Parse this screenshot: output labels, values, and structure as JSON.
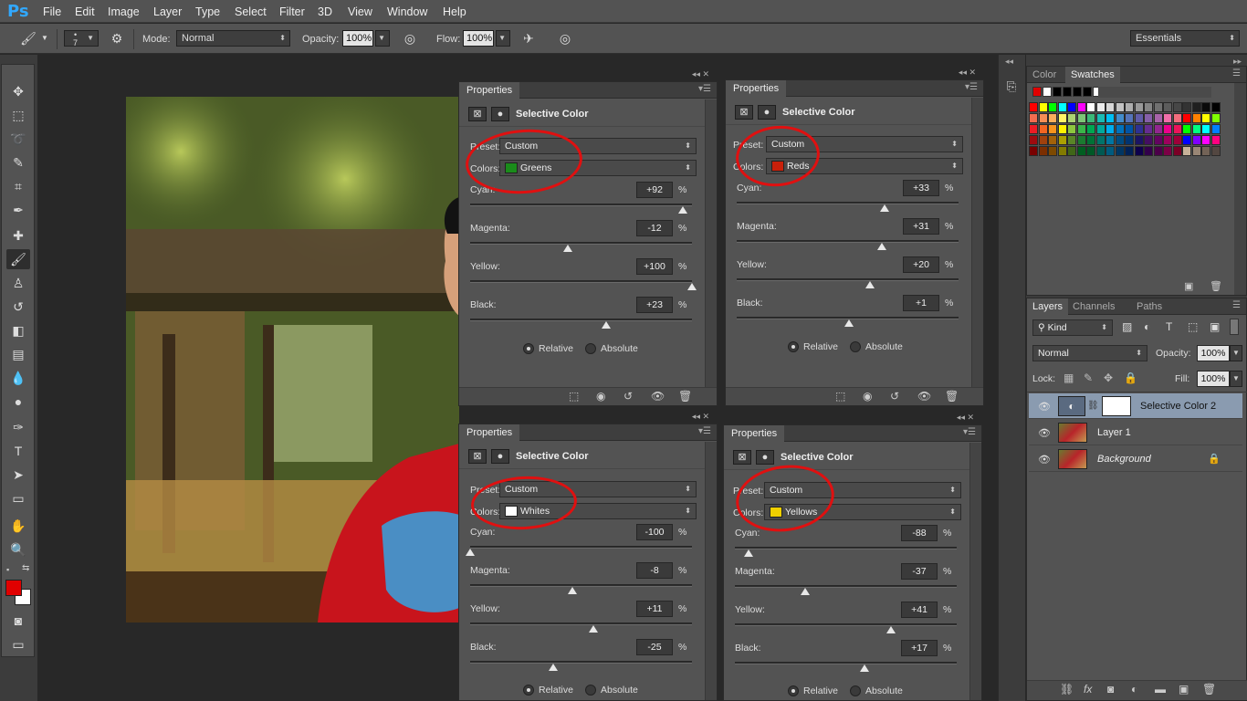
{
  "app": {
    "logo": "Ps",
    "menu": [
      "File",
      "Edit",
      "Image",
      "Layer",
      "Type",
      "Select",
      "Filter",
      "3D",
      "View",
      "Window",
      "Help"
    ]
  },
  "options_bar": {
    "brush_size": "7",
    "mode_label": "Mode:",
    "mode_value": "Normal",
    "opacity_label": "Opacity:",
    "opacity_value": "100%",
    "flow_label": "Flow:",
    "flow_value": "100%",
    "workspace": "Essentials"
  },
  "tools": {
    "foreground_color": "#e00000",
    "background_color": "#ffffff"
  },
  "panels": [
    {
      "tab": "Properties",
      "title": "Selective Color",
      "preset_label": "Preset:",
      "preset_value": "Custom",
      "colors_label": "Colors:",
      "colors_value": "Greens",
      "colors_swatch": "#1a8c1a",
      "sliders": [
        {
          "label": "Cyan:",
          "value": "+92",
          "level": 0.96
        },
        {
          "label": "Magenta:",
          "value": "-12",
          "level": 0.44
        },
        {
          "label": "Yellow:",
          "value": "+100",
          "level": 1.0
        },
        {
          "label": "Black:",
          "value": "+23",
          "level": 0.615
        }
      ],
      "pct": "%",
      "relative": "Relative",
      "absolute": "Absolute",
      "mode": "relative"
    },
    {
      "tab": "Properties",
      "title": "Selective Color",
      "preset_label": "Preset:",
      "preset_value": "Custom",
      "colors_label": "Colors:",
      "colors_value": "Reds",
      "colors_swatch": "#c8200a",
      "sliders": [
        {
          "label": "Cyan:",
          "value": "+33",
          "level": 0.665
        },
        {
          "label": "Magenta:",
          "value": "+31",
          "level": 0.655
        },
        {
          "label": "Yellow:",
          "value": "+20",
          "level": 0.6
        },
        {
          "label": "Black:",
          "value": "+1",
          "level": 0.505
        }
      ],
      "pct": "%",
      "relative": "Relative",
      "absolute": "Absolute",
      "mode": "relative"
    },
    {
      "tab": "Properties",
      "title": "Selective Color",
      "preset_label": "Preset:",
      "preset_value": "Custom",
      "colors_label": "Colors:",
      "colors_value": "Whites",
      "colors_swatch": "#ffffff",
      "sliders": [
        {
          "label": "Cyan:",
          "value": "-100",
          "level": 0.0
        },
        {
          "label": "Magenta:",
          "value": "-8",
          "level": 0.46
        },
        {
          "label": "Yellow:",
          "value": "+11",
          "level": 0.555
        },
        {
          "label": "Black:",
          "value": "-25",
          "level": 0.375
        }
      ],
      "pct": "%",
      "relative": "Relative",
      "absolute": "Absolute",
      "mode": "relative"
    },
    {
      "tab": "Properties",
      "title": "Selective Color",
      "preset_label": "Preset:",
      "preset_value": "Custom",
      "colors_label": "Colors:",
      "colors_value": "Yellows",
      "colors_swatch": "#f0d000",
      "sliders": [
        {
          "label": "Cyan:",
          "value": "-88",
          "level": 0.06
        },
        {
          "label": "Magenta:",
          "value": "-37",
          "level": 0.315
        },
        {
          "label": "Yellow:",
          "value": "+41",
          "level": 0.705
        },
        {
          "label": "Black:",
          "value": "+17",
          "level": 0.585
        }
      ],
      "pct": "%",
      "relative": "Relative",
      "absolute": "Absolute",
      "mode": "relative"
    }
  ],
  "color_panel": {
    "tabs": [
      "Color",
      "Swatches"
    ],
    "recent": [
      "#e00000",
      "#ffffff",
      "#000000",
      "#000000",
      "#000000",
      "#000000",
      "#ffffff"
    ],
    "rows": [
      [
        "#ff0000",
        "#ffff00",
        "#00ff00",
        "#00ffff",
        "#0000ff",
        "#ff00ff",
        "#ffffff",
        "#ebebeb",
        "#d6d6d6",
        "#c2c2c2",
        "#adadad",
        "#999999",
        "#858585",
        "#707070",
        "#5c5c5c",
        "#474747",
        "#333333",
        "#1f1f1f",
        "#0a0a0a",
        "#000000"
      ],
      [
        "#f26c4f",
        "#f68e55",
        "#fbaf5c",
        "#fff467",
        "#acd372",
        "#7cc576",
        "#3bb878",
        "#1abbb4",
        "#00bff3",
        "#438ccb",
        "#5574b9",
        "#605ca8",
        "#855fa8",
        "#a763a8",
        "#f06ea9",
        "#f26d7d",
        "#ff0000",
        "#ff8000",
        "#ffff00",
        "#80ff00"
      ],
      [
        "#ed1c24",
        "#f26522",
        "#f7941d",
        "#fff200",
        "#8dc63f",
        "#39b54a",
        "#00a651",
        "#00a99d",
        "#00aeef",
        "#0072bc",
        "#0054a6",
        "#2e3192",
        "#662d91",
        "#92278f",
        "#ec008c",
        "#ed145b",
        "#00ff00",
        "#00ff80",
        "#00ffff",
        "#0080ff"
      ],
      [
        "#9e0b0f",
        "#a0410d",
        "#a36209",
        "#aba000",
        "#598527",
        "#1a7b30",
        "#007236",
        "#00746b",
        "#0076a3",
        "#004b80",
        "#003471",
        "#1b1464",
        "#440e62",
        "#630460",
        "#9e005d",
        "#9e0039",
        "#0000ff",
        "#8000ff",
        "#ff00ff",
        "#ff0080"
      ],
      [
        "#790000",
        "#7b2e00",
        "#7d4900",
        "#827b00",
        "#406618",
        "#005e20",
        "#005826",
        "#005952",
        "#005b7f",
        "#003663",
        "#002157",
        "#0d004c",
        "#32004b",
        "#4b0049",
        "#7b0046",
        "#7a0026",
        "#c7b299",
        "#998675",
        "#736357",
        "#534741"
      ]
    ]
  },
  "layers_panel": {
    "tabs": [
      "Layers",
      "Channels",
      "Paths"
    ],
    "kind": "Kind",
    "blend": "Normal",
    "opacity_label": "Opacity:",
    "opacity_value": "100%",
    "lock_label": "Lock:",
    "fill_label": "Fill:",
    "fill_value": "100%",
    "layers": [
      {
        "name": "Selective Color 2",
        "selected": true,
        "type": "adjustment"
      },
      {
        "name": "Layer 1",
        "selected": false,
        "type": "pixel"
      },
      {
        "name": "Background",
        "selected": false,
        "type": "pixel",
        "locked": true
      }
    ]
  }
}
